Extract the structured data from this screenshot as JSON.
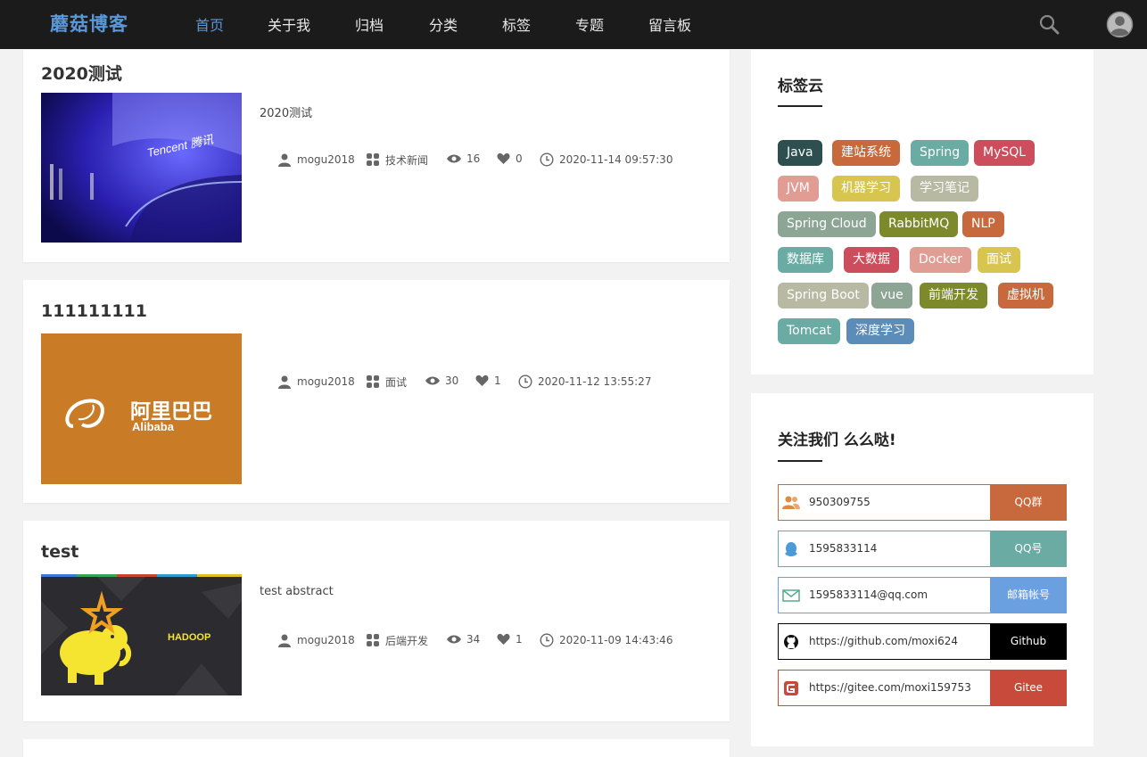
{
  "header": {
    "logo": "蘑菇博客",
    "nav": [
      "首页",
      "关于我",
      "归档",
      "分类",
      "标签",
      "专题",
      "留言板"
    ],
    "active_index": 0
  },
  "articles": [
    {
      "title": "2020测试",
      "abstract": "2020测试",
      "author": "mogu2018",
      "category": "技术新闻",
      "views": "16",
      "likes": "0",
      "date": "2020-11-14 09:57:30",
      "thumb": "tencent",
      "thumb_text": "Tencent 腾讯"
    },
    {
      "title": "111111111",
      "abstract": "",
      "author": "mogu2018",
      "category": "面试",
      "views": "30",
      "likes": "1",
      "date": "2020-11-12 13:55:27",
      "thumb": "alibaba",
      "thumb_text": "阿里巴巴",
      "thumb_sub": "Alibaba"
    },
    {
      "title": "test",
      "abstract": "test abstract",
      "author": "mogu2018",
      "category": "后端开发",
      "views": "34",
      "likes": "1",
      "date": "2020-11-09 14:43:46",
      "thumb": "hadoop",
      "thumb_text": "HADOOP"
    }
  ],
  "tag_cloud": {
    "title": "标签云",
    "tags": [
      {
        "label": "Java",
        "color": "#2e4f4f"
      },
      {
        "label": "建站系统",
        "color": "#c8693d"
      },
      {
        "label": "Spring",
        "color": "#6aaba3"
      },
      {
        "label": "MySQL",
        "color": "#cc4e5c"
      },
      {
        "label": "JVM",
        "color": "#e19c94"
      },
      {
        "label": "机器学习",
        "color": "#d8c550"
      },
      {
        "label": "学习笔记",
        "color": "#b7b9a2"
      },
      {
        "label": "Spring Cloud",
        "color": "#8ca594"
      },
      {
        "label": "RabbitMQ",
        "color": "#7d8a2c"
      },
      {
        "label": "NLP",
        "color": "#c8693d"
      },
      {
        "label": "数据库",
        "color": "#6aaba3"
      },
      {
        "label": "大数据",
        "color": "#cc4e5c"
      },
      {
        "label": "Docker",
        "color": "#e19c94"
      },
      {
        "label": "面试",
        "color": "#d8c550"
      },
      {
        "label": "Spring Boot",
        "color": "#b7b9a2"
      },
      {
        "label": "vue",
        "color": "#8ca594"
      },
      {
        "label": "前端开发",
        "color": "#7d8a2c"
      },
      {
        "label": "虚拟机",
        "color": "#c8693d"
      },
      {
        "label": "Tomcat",
        "color": "#6aaba3"
      },
      {
        "label": "深度学习",
        "color": "#5b8db8"
      }
    ]
  },
  "follow": {
    "title": "关注我们 么么哒!",
    "items": [
      {
        "icon": "users-icon",
        "value": "950309755",
        "button": "QQ群",
        "color": "#c8693d"
      },
      {
        "icon": "qq-icon",
        "value": "1595833114",
        "button": "QQ号",
        "color": "#6aaba3"
      },
      {
        "icon": "mail-icon",
        "value": "1595833114@qq.com",
        "button": "邮箱帐号",
        "color": "#6a9fe0"
      },
      {
        "icon": "github-icon",
        "value": "https://github.com/moxi624",
        "button": "Github",
        "color": "#000000"
      },
      {
        "icon": "gitee-icon",
        "value": "https://gitee.com/moxi159753",
        "button": "Gitee",
        "color": "#c74a3a"
      }
    ]
  }
}
